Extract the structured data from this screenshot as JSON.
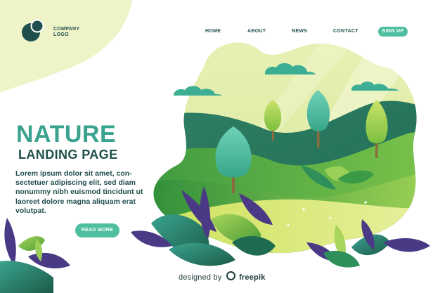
{
  "logo": {
    "line1": "COMPANY",
    "line2": "LOGO"
  },
  "nav": {
    "items": [
      {
        "label": "HOME"
      },
      {
        "label": "ABOUT"
      },
      {
        "label": "NEWS"
      },
      {
        "label": "CONTACT"
      }
    ],
    "signup_label": "SIGN UP"
  },
  "hero": {
    "title_line1": "NATURE",
    "title_line2": "LANDING PAGE",
    "body": "Lorem ipsum dolor sit amet, con-sectetuer adipiscing elit, sed diam nonummy nibh euismod tincidunt ut laoreet dolore magna aliquam erat volutpat.",
    "button_label": "READ MORE"
  },
  "credit": {
    "prefix": "designed by",
    "brand": "freepik"
  },
  "colors": {
    "accent": "#4dbf9f",
    "title": "#3aa38f",
    "dark_text": "#1f4f4c",
    "corner_blob": "#eef3c8"
  },
  "icons": [
    "logo-circles-icon",
    "cloud-icon",
    "tree-icon",
    "leaf-icon",
    "freepik-icon"
  ]
}
